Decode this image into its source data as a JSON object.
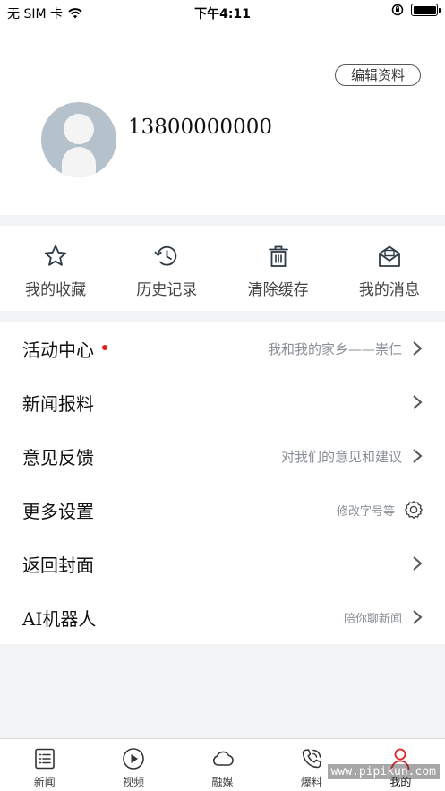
{
  "status_bar": {
    "carrier": "无 SIM 卡",
    "time": "下午4:11"
  },
  "profile": {
    "edit_label": "编辑资料",
    "phone": "13800000000"
  },
  "quick_actions": [
    {
      "label": "我的收藏",
      "icon": "star-icon"
    },
    {
      "label": "历史记录",
      "icon": "history-clock-icon"
    },
    {
      "label": "清除缓存",
      "icon": "trash-icon"
    },
    {
      "label": "我的消息",
      "icon": "envelope-icon"
    }
  ],
  "menu": [
    {
      "title": "活动中心",
      "subtitle": "我和我的家乡——崇仁",
      "has_dot": true,
      "right_icon": "chevron-right-icon"
    },
    {
      "title": "新闻报料",
      "subtitle": "",
      "right_icon": "chevron-right-icon"
    },
    {
      "title": "意见反馈",
      "subtitle": "对我们的意见和建议",
      "right_icon": "chevron-right-icon"
    },
    {
      "title": "更多设置",
      "subtitle": "修改字号等",
      "right_icon": "gear-icon"
    },
    {
      "title": "返回封面",
      "subtitle": "",
      "right_icon": "chevron-right-icon"
    },
    {
      "title": "AI机器人",
      "subtitle": "陪你聊新闻",
      "right_icon": "chevron-right-icon"
    }
  ],
  "tabbar": [
    {
      "label": "新闻",
      "icon": "news-list-icon"
    },
    {
      "label": "视频",
      "icon": "play-circle-icon"
    },
    {
      "label": "融媒",
      "icon": "cloud-icon"
    },
    {
      "label": "爆料",
      "icon": "phone-call-icon"
    },
    {
      "label": "我的",
      "icon": "person-icon",
      "active": true
    }
  ],
  "colors": {
    "accent_red": "#e01f1f",
    "icon_dark": "#2e3a45",
    "page_bg": "#f2f3f5"
  },
  "watermark": "www.pipikun.com"
}
